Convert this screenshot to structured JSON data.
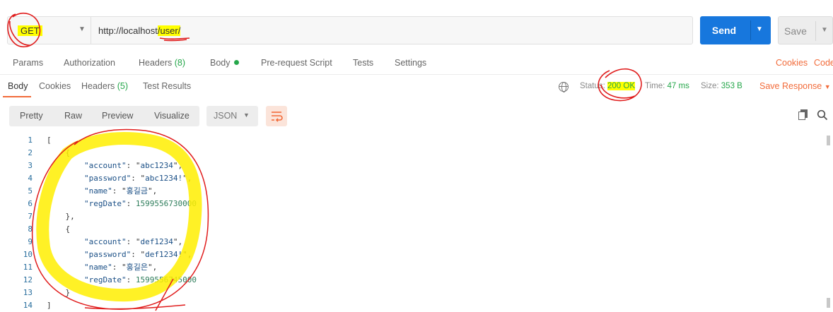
{
  "request": {
    "method": "GET",
    "url_base": "http://localhost",
    "url_path": "/user/",
    "send_label": "Send",
    "save_label": "Save"
  },
  "request_tabs": [
    {
      "label": "Params"
    },
    {
      "label": "Authorization"
    },
    {
      "label": "Headers",
      "count": "(8)"
    },
    {
      "label": "Body"
    },
    {
      "label": "Pre-request Script"
    },
    {
      "label": "Tests"
    },
    {
      "label": "Settings"
    }
  ],
  "links": {
    "cookies": "Cookies",
    "code": "Code"
  },
  "response": {
    "tabs": [
      {
        "label": "Body"
      },
      {
        "label": "Cookies"
      },
      {
        "label": "Headers",
        "count": "(5)"
      },
      {
        "label": "Test Results"
      }
    ],
    "status_label": "Status:",
    "status_value": "200 OK",
    "time_label": "Time:",
    "time_value": "47 ms",
    "size_label": "Size:",
    "size_value": "353 B",
    "save_response": "Save Response"
  },
  "view": {
    "modes": [
      "Pretty",
      "Raw",
      "Preview",
      "Visualize"
    ],
    "format": "JSON"
  },
  "body": {
    "line_numbers": [
      "1",
      "2",
      "3",
      "4",
      "5",
      "6",
      "7",
      "8",
      "9",
      "10",
      "11",
      "12",
      "13",
      "14"
    ],
    "users": [
      {
        "account": "abc1234",
        "password": "abc1234!",
        "name": "홍길금",
        "regDate": "1599556730000"
      },
      {
        "account": "def1234",
        "password": "def1234!",
        "name": "홍길은",
        "regDate": "1599556745000"
      }
    ]
  },
  "colors": {
    "accent": "#f26b3a",
    "send": "#1777dd",
    "success": "#26a74b",
    "highlight": "#ffff00",
    "annotation": "#e01c1c"
  }
}
